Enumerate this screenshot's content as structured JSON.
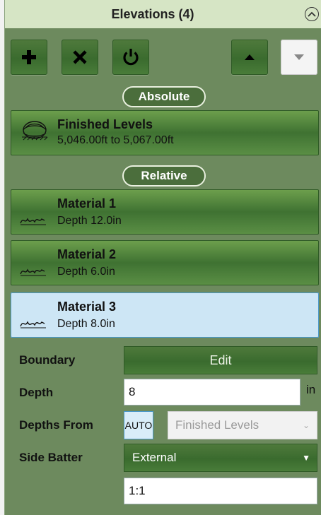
{
  "header": {
    "title": "Elevations (4)"
  },
  "toolbar": {
    "add_icon": "plus-icon",
    "delete_icon": "x-icon",
    "power_icon": "power-icon",
    "up_icon": "triangle-up-icon",
    "down_icon": "triangle-down-icon"
  },
  "sections": {
    "absolute": "Absolute",
    "relative": "Relative"
  },
  "absolute_items": [
    {
      "name": "Finished Levels",
      "detail": "5,046.00ft to 5,067.00ft",
      "icon": "terrain-layers-icon"
    }
  ],
  "relative_items": [
    {
      "name": "Material 1",
      "detail": "Depth 12.0in",
      "icon": "material-hatch-icon",
      "selected": false
    },
    {
      "name": "Material 2",
      "detail": "Depth 6.0in",
      "icon": "material-hatch-icon",
      "selected": false
    },
    {
      "name": "Material 3",
      "detail": "Depth 8.0in",
      "icon": "material-hatch-icon",
      "selected": true
    }
  ],
  "properties": {
    "boundary_label": "Boundary",
    "edit_label": "Edit",
    "depth_label": "Depth",
    "depth_value": "8",
    "depth_unit": "in",
    "depths_from_label": "Depths From",
    "auto_label": "AUTO",
    "depths_from_value": "Finished Levels",
    "side_batter_label": "Side Batter",
    "side_batter_value": "External",
    "batter_ratio": "1:1"
  },
  "colors": {
    "panel": "#6d8a5e",
    "header": "#d6e5c5",
    "button_green": "#3a6b2e",
    "selected": "#cde6f5"
  }
}
